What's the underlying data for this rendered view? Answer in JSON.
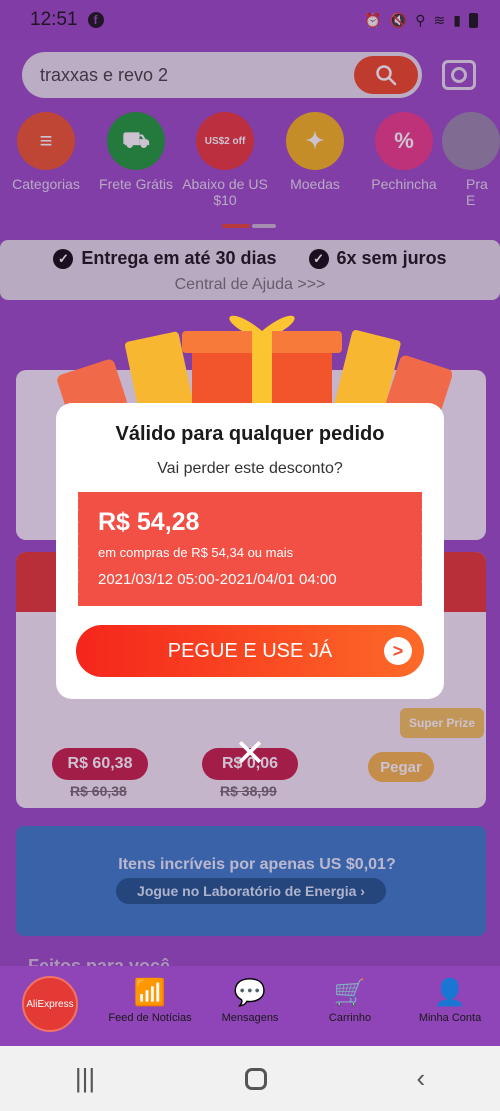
{
  "status_bar": {
    "time": "12:51",
    "facebook_glyph": "f"
  },
  "search": {
    "query": "traxxas e revo 2"
  },
  "categories": [
    {
      "label": "Categorias",
      "color": "#ee5a2e",
      "glyph": "≡"
    },
    {
      "label": "Frete Grátis",
      "color": "#1f9e3a",
      "glyph": "⛟"
    },
    {
      "label": "Abaixo de US $10",
      "color": "#ea3b3b",
      "glyph": "US$2 off"
    },
    {
      "label": "Moedas",
      "color": "#f4b81d",
      "glyph": "✦"
    },
    {
      "label": "Pechincha",
      "color": "#ec3f8a",
      "glyph": "%"
    },
    {
      "label": "Pra E",
      "color": "#9a8cab",
      "glyph": ""
    }
  ],
  "benefits": {
    "delivery": "Entrega em até 30 dias",
    "installments": "6x sem juros",
    "check_glyph": "✓",
    "help_link": "Central de Ajuda >>>"
  },
  "deals": [
    {
      "price": "R$ 60,38",
      "old_price": "R$ 60,38"
    },
    {
      "price": "R$ 0,06",
      "old_price": "R$ 38,99"
    }
  ],
  "prize": {
    "badge": "Super Prize",
    "button": "Pegar"
  },
  "energy_banner": {
    "headline": "Itens incríveis por apenas US $0,01?",
    "cta": "Jogue no Laboratório de Energia ›"
  },
  "feed_title": "Feitos para você",
  "bottom_nav": {
    "logo": "AliExpress",
    "items": [
      "Feed de Notícias",
      "Mensagens",
      "Carrinho",
      "Minha Conta"
    ]
  },
  "modal": {
    "title": "Válido para qualquer pedido",
    "subtitle": "Vai perder este desconto?",
    "coupon": {
      "amount": "R$ 54,28",
      "minimum": "em compras de R$ 54,34 ou mais",
      "period": "2021/03/12 05:00-2021/04/01 04:00"
    },
    "cta": "PEGUE E USE JÁ",
    "cta_arrow": ">",
    "close_glyph": "✕"
  },
  "colors": {
    "accent": "#f24f45",
    "purple_bg": "#9a4fc6"
  }
}
